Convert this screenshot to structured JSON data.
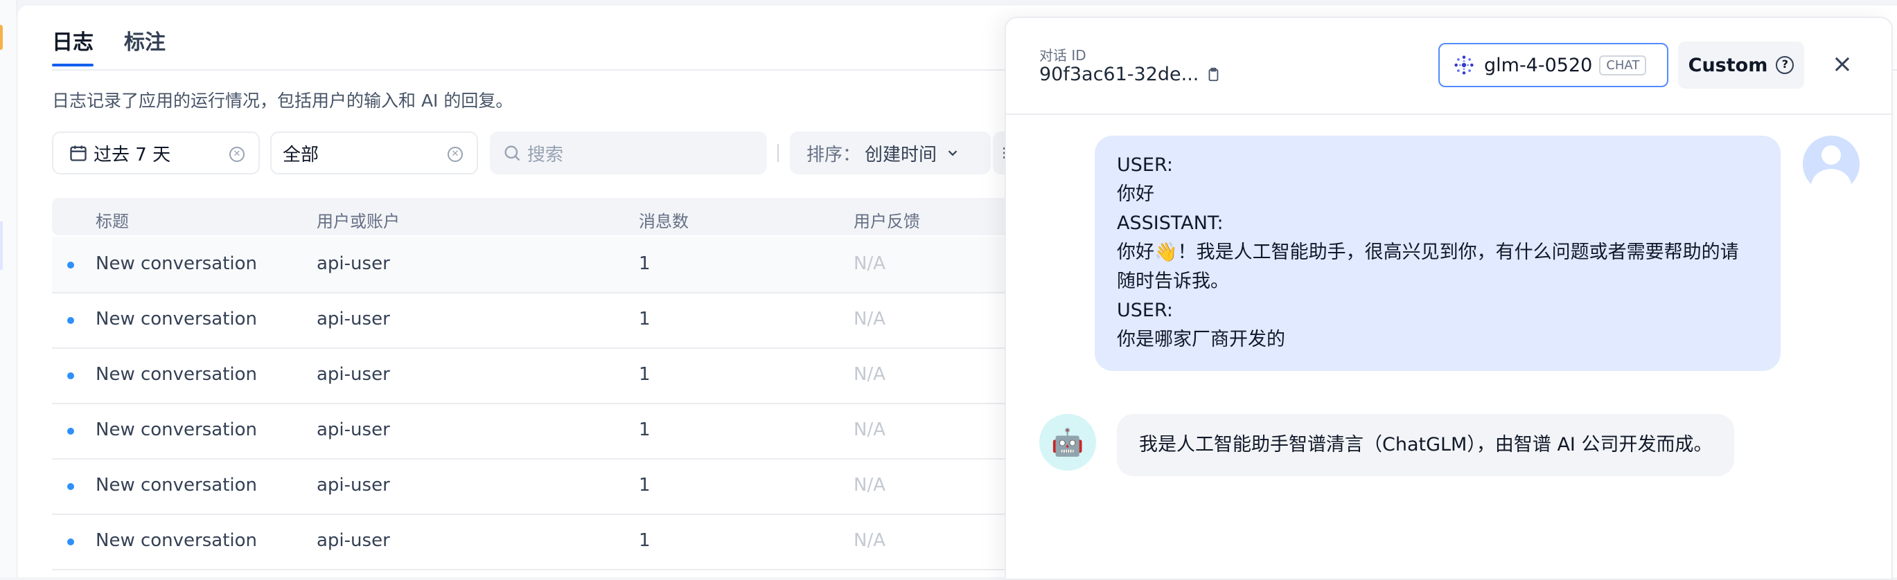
{
  "tabs": [
    {
      "label": "日志",
      "active": true
    },
    {
      "label": "标注",
      "active": false
    }
  ],
  "description": "日志记录了应用的运行情况，包括用户的输入和 AI 的回复。",
  "filters": {
    "date_range": "过去 7 天",
    "status": "全部",
    "search_placeholder": "搜索",
    "sort_label": "排序：",
    "sort_value": "创建时间"
  },
  "table": {
    "columns": [
      "标题",
      "用户或账户",
      "消息数",
      "用户反馈"
    ],
    "rows": [
      {
        "title": "New conversation",
        "user": "api-user",
        "messages": "1",
        "feedback": "N/A"
      },
      {
        "title": "New conversation",
        "user": "api-user",
        "messages": "1",
        "feedback": "N/A"
      },
      {
        "title": "New conversation",
        "user": "api-user",
        "messages": "1",
        "feedback": "N/A"
      },
      {
        "title": "New conversation",
        "user": "api-user",
        "messages": "1",
        "feedback": "N/A"
      },
      {
        "title": "New conversation",
        "user": "api-user",
        "messages": "1",
        "feedback": "N/A"
      },
      {
        "title": "New conversation",
        "user": "api-user",
        "messages": "1",
        "feedback": "N/A"
      }
    ]
  },
  "drawer": {
    "conversation_label": "对话 ID",
    "conversation_id": "90f3ac61-32de...",
    "model_name": "glm-4-0520",
    "model_badge": "CHAT",
    "custom_label": "Custom",
    "user_message_lines": [
      "USER:",
      "你好",
      "ASSISTANT:",
      "你好👋！我是人工智能助手，很高兴见到你，有什么问题或者需要帮助的请",
      "随时告诉我。",
      "USER:",
      "你是哪家厂商开发的"
    ],
    "assistant_message": "我是人工智能助手智谱清言（ChatGLM），由智谱 AI 公司开发而成。",
    "bot_avatar_emoji": "🤖"
  },
  "colors": {
    "accent": "#155eef",
    "user_bubble": "#e1eaff",
    "status_dot": "#2e90fa"
  }
}
